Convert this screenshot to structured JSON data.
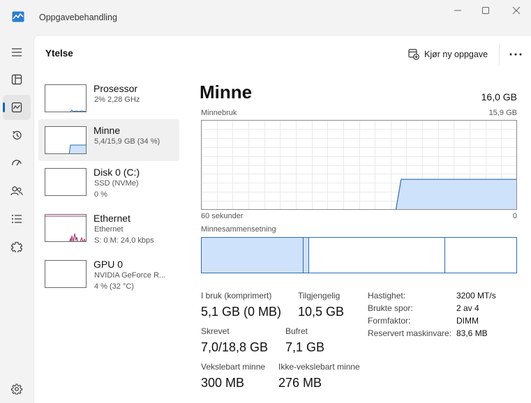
{
  "app": {
    "title": "Oppgavebehandling",
    "icon": "task-manager-icon"
  },
  "window_controls": [
    "minimize-icon",
    "maximize-icon",
    "close-icon"
  ],
  "nav": {
    "items": [
      {
        "name": "hamburger-menu-icon",
        "active": false
      },
      {
        "name": "processes-icon",
        "active": false
      },
      {
        "name": "performance-icon",
        "active": true
      },
      {
        "name": "app-history-icon",
        "active": false
      },
      {
        "name": "startup-apps-icon",
        "active": false
      },
      {
        "name": "users-icon",
        "active": false
      },
      {
        "name": "details-icon",
        "active": false
      },
      {
        "name": "services-icon",
        "active": false
      }
    ],
    "settings_icon": "gear-icon"
  },
  "header": {
    "page_title": "Ytelse",
    "run_task_label": "Kjør ny oppgave",
    "more_icon": "more-icon"
  },
  "resources": [
    {
      "name": "Prosessor",
      "sub1": "2% 2,28 GHz",
      "sub2": "",
      "selected": false
    },
    {
      "name": "Minne",
      "sub1": "5,4/15,9 GB (34 %)",
      "sub2": "",
      "selected": true
    },
    {
      "name": "Disk 0 (C:)",
      "sub1": "SSD (NVMe)",
      "sub2": "0 %",
      "selected": false
    },
    {
      "name": "Ethernet",
      "sub1": "Ethernet",
      "sub2": "S: 0 M: 24,0 kbps",
      "selected": false
    },
    {
      "name": "GPU 0",
      "sub1": "NVIDIA GeForce R...",
      "sub2": "4 % (32 °C)",
      "selected": false
    }
  ],
  "detail": {
    "title": "Minne",
    "total": "16,0 GB",
    "usage_label": "Minnebruk",
    "usage_max": "15,9 GB",
    "axis_left": "60 sekunder",
    "axis_right": "0",
    "composition_label": "Minnesammensetning",
    "stats": [
      {
        "label": "I bruk (komprimert)",
        "value": "5,1 GB (0 MB)"
      },
      {
        "label": "Tilgjengelig",
        "value": "10,5 GB"
      },
      {
        "label": "Skrevet",
        "value": "7,0/18,8 GB"
      },
      {
        "label": "Bufret",
        "value": "7,1 GB"
      },
      {
        "label": "Vekslebart minne",
        "value": "300 MB"
      },
      {
        "label": "Ikke-vekslebart minne",
        "value": "276 MB"
      }
    ],
    "properties": [
      {
        "key": "Hastighet:",
        "value": "3200 MT/s"
      },
      {
        "key": "Brukte spor:",
        "value": "2 av 4"
      },
      {
        "key": "Formfaktor:",
        "value": "DIMM"
      },
      {
        "key": "Reservert maskinvare:",
        "value": "83,6 MB"
      }
    ]
  },
  "colors": {
    "accent": "#0067c0",
    "memory_line": "#2b6cb0",
    "memory_fill": "#cfe2fb",
    "ethernet_line": "#a4376b"
  },
  "chart_data": {
    "type": "area",
    "xlabel": "60 sekunder",
    "ylim": [
      0,
      15.9
    ],
    "xlim": [
      60,
      0
    ],
    "x": [
      60,
      55,
      50,
      45,
      40,
      35,
      30,
      25,
      24,
      23,
      22,
      20,
      15,
      10,
      5,
      0
    ],
    "series": [
      {
        "values": [
          null,
          null,
          null,
          null,
          null,
          null,
          null,
          null,
          null,
          0,
          5.4,
          5.4,
          5.4,
          5.4,
          5.4,
          5.4
        ]
      }
    ]
  }
}
